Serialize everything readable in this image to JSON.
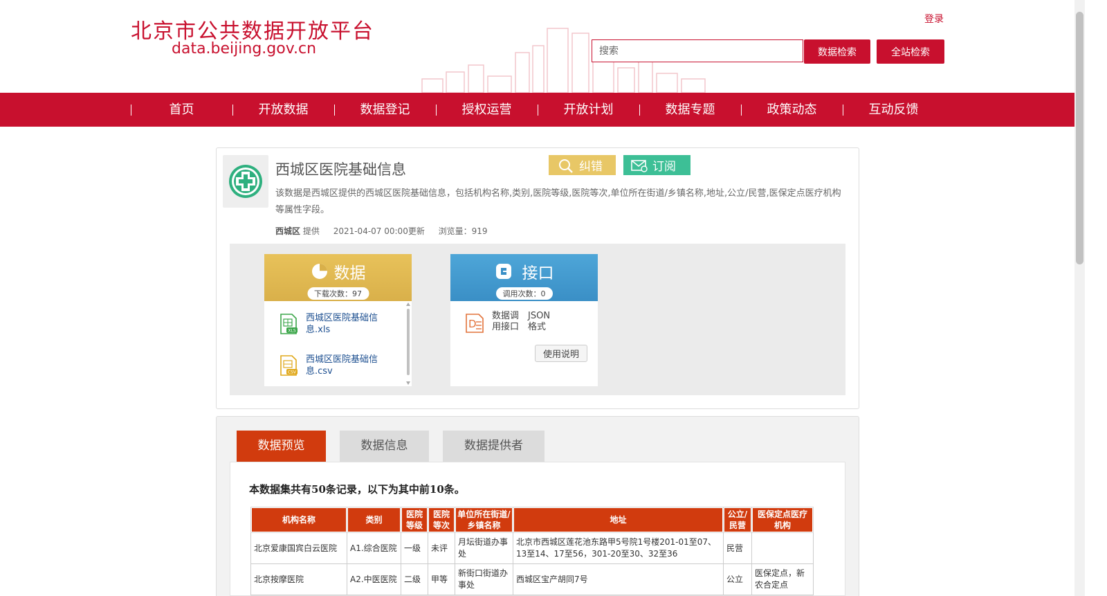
{
  "site": {
    "title_cn": "北京市公共数据开放平台",
    "url": "data.beijing.gov.cn",
    "login": "登录",
    "search_placeholder": "搜索",
    "data_search": "数据检索",
    "site_search": "全站检索"
  },
  "nav": [
    "首页",
    "开放数据",
    "数据登记",
    "授权运营",
    "开放计划",
    "数据专题",
    "政策动态",
    "互动反馈"
  ],
  "dataset": {
    "title": "西城区医院基础信息",
    "correct_label": "纠错",
    "subscribe_label": "订阅",
    "description": "该数据是西城区提供的西城区医院基础信息，包括机构名称,类别,医院等级,医院等次,单位所在街道/乡镇名称,地址,公立/民营,医保定点医疗机构等属性字段。",
    "provider": "西城区",
    "provider_suffix": "提供",
    "updated": "2021-04-07 00:00更新",
    "views": "浏览量：919"
  },
  "data_card": {
    "title": "数据",
    "downloads": "下载次数：97",
    "files": [
      {
        "name": "西城区医院基础信息.xls",
        "icon": "xls-file-icon",
        "color": "#3aa548"
      },
      {
        "name": "西城区医院基础信息.csv",
        "icon": "csv-file-icon",
        "color": "#e0a81a"
      }
    ]
  },
  "api_card": {
    "title": "接口",
    "calls": "调用次数：0",
    "item_name": "数据调用接口",
    "item_format": "JSON格式",
    "usage_button": "使用说明"
  },
  "tabs": [
    "数据预览",
    "数据信息",
    "数据提供者"
  ],
  "preview": {
    "note": "本数据集共有50条记录，以下为其中前10条。",
    "columns": [
      "机构名称",
      "类别",
      "医院等级",
      "医院等次",
      "单位所在街道/乡镇名称",
      "地址",
      "公立/民营",
      "医保定点医疗机构"
    ],
    "rows": [
      [
        "北京爱康国宾白云医院",
        "A1.综合医院",
        "一级",
        "未评",
        "月坛街道办事处",
        "北京市西城区莲花池东路甲5号院1号楼201-01至07、13至14、17至56，301-20至30、32至36",
        "民营",
        ""
      ],
      [
        "北京按摩医院",
        "A2.中医医院",
        "二级",
        "甲等",
        "新街口街道办事处",
        "西城区宝产胡同7号",
        "公立",
        "医保定点，新农合定点"
      ]
    ]
  },
  "colors": {
    "brand_red": "#c8102e",
    "tab_active": "#d13b0e",
    "correct_yellow": "#e8c766",
    "subscribe_green": "#3dbf96"
  }
}
